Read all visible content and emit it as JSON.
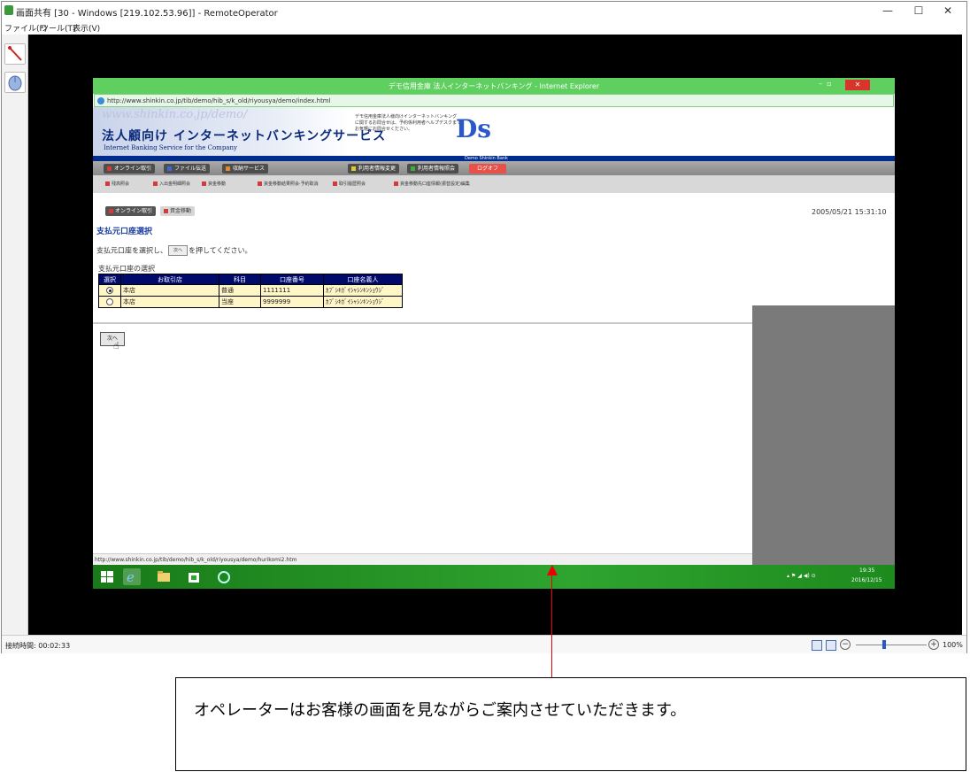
{
  "ro": {
    "title": "画面共有 [30 - Windows [219.102.53.96]] - RemoteOperator",
    "controls": {
      "minimize": "—",
      "maximize": "☐",
      "close": "✕"
    },
    "menu": [
      "ファイル(F)",
      "ツール(T)",
      "表示(V)"
    ],
    "tools": [
      "pen-tool-icon",
      "mouse-icon"
    ],
    "status": {
      "connection_time": "接続時間: 00:02:33",
      "zoom": "100%"
    }
  },
  "ie": {
    "title": "デモ信用金庫 法人インターネットバンキング - Internet Explorer",
    "address": "http://www.shinkin.co.jp/tib/demo/hib_s/k_old/riyousya/demo/index.html",
    "status_url": "http://www.shinkin.co.jp/tib/demo/hib_s/k_old/riyousya/demo/hurikomi2.htm"
  },
  "bank": {
    "watermark": "www.shinkin.co.jp/demo/",
    "title": "法人顧向け インターネットバンキングサービス",
    "subtitle": "Internet Banking Service for the Company",
    "notice": "デモ信用金庫法人様向けインターネットバンキングに関するお問合せは、予約係利用者ヘルプデスクまでお気軽にお問合せください。",
    "logo": "Ds",
    "bank_name": "Demo Shinkin Bank",
    "nav_main": [
      {
        "label": "オンライン取引",
        "color": "#d43a3a"
      },
      {
        "label": "ファイル伝送",
        "color": "#3a6ad4"
      },
      {
        "label": "収納サービス",
        "color": "#e08a2a"
      },
      {
        "label": "利用者情報変更",
        "color": "#e0c82a"
      },
      {
        "label": "利用者情報照会",
        "color": "#3ab03a"
      },
      {
        "label": "ログオフ",
        "color": "#e8504a"
      }
    ],
    "nav_sub": [
      "残高照会",
      "入出金明細照会",
      "資金移動",
      "資金移動結果照会·予約取消",
      "取引履歴照会",
      "資金移動先口座情報(振替設定)編集"
    ]
  },
  "page": {
    "crumbs": [
      "オンライン取引",
      "資金移動"
    ],
    "timestamp": "2005/05/21 15:31:10",
    "heading": "支払元口座選択",
    "instruction_pre": "支払元口座を選択し、",
    "instruction_btn": "次へ",
    "instruction_post": "を押してください。",
    "table_caption": "支払元口座の選択",
    "table_headers": [
      "選択",
      "お取引店",
      "科目",
      "口座番号",
      "口座名義人"
    ],
    "rows": [
      {
        "selected": true,
        "branch": "本店",
        "type": "普通",
        "number": "1111111",
        "holder": "ｶﾌﾞｼｷｶﾞｲｼｬｼﾝｷﾝｼｮｳｼﾞ"
      },
      {
        "selected": false,
        "branch": "本店",
        "type": "当座",
        "number": "9999999",
        "holder": "ｶﾌﾞｼｷｶﾞｲｼｬｼﾝｷﾝｼｮｳｼﾞ"
      }
    ],
    "next_button": "次へ"
  },
  "taskbar": {
    "time": "19:35",
    "date": "2016/12/15",
    "icons": [
      "windows-start-icon",
      "internet-explorer-icon",
      "file-explorer-icon",
      "store-icon",
      "remote-support-icon"
    ]
  },
  "annotation": {
    "caption": "オペレーターはお客様の画面を見ながらご案内させていただきます。"
  }
}
